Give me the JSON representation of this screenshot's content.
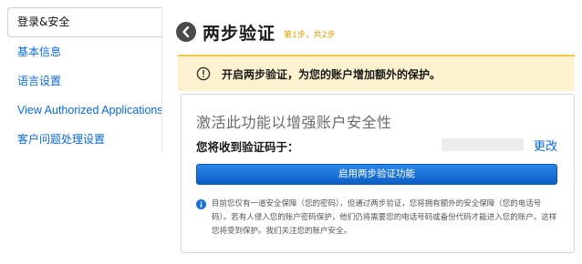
{
  "sidebar": {
    "active_item": "登录&安全",
    "items": [
      {
        "label": "基本信息"
      },
      {
        "label": "语言设置"
      },
      {
        "label": "View Authorized Applications"
      },
      {
        "label": "客户问题处理设置"
      }
    ]
  },
  "header": {
    "back_icon": "chevron-left-icon",
    "title": "两步验证",
    "step_text": "第1步，共2步"
  },
  "banner": {
    "icon": "warning-circle-icon",
    "text": "开启两步验证，为您的账户增加额外的保护。"
  },
  "card": {
    "title": "激活此功能以增强账户安全性",
    "code_label": "您将收到验证码于：",
    "change_link": "更改",
    "enable_button": "启用两步验证功能",
    "info_icon": "info-icon",
    "info_text": "目前您仅有一道安全保障（您的密码），但通过两步验证，您将拥有额外的安全保障（您的电话号码）。若有人侵入您的账户密码保护，他们仍将需要您的电话号码或备份代码才能进入您的账户。这样您将受到保护。我们关注您的账户安全。"
  },
  "colors": {
    "link": "#0a6ad8",
    "step_accent": "#e0a000",
    "banner_bg": "#fdf2cf",
    "primary_button": "#1a74dc"
  }
}
